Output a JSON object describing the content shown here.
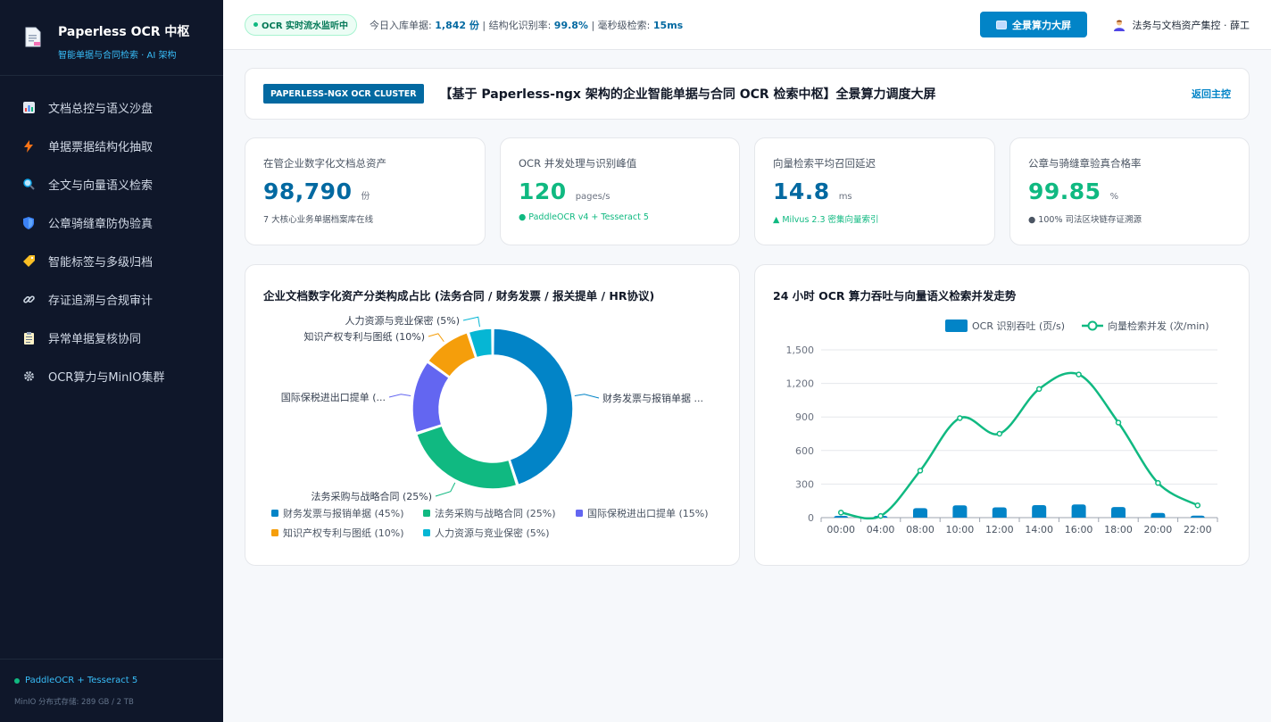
{
  "sidebar": {
    "title": "Paperless OCR 中枢",
    "subtitle": "智能单据与合同检索 · AI 架构",
    "items": [
      {
        "label": "文档总控与语义沙盘",
        "icon": "bar-chart-icon"
      },
      {
        "label": "单据票据结构化抽取",
        "icon": "lightning-icon"
      },
      {
        "label": "全文与向量语义检索",
        "icon": "magnifier-icon"
      },
      {
        "label": "公章骑缝章防伪验真",
        "icon": "shield-icon"
      },
      {
        "label": "智能标签与多级归档",
        "icon": "tag-icon"
      },
      {
        "label": "存证追溯与合规审计",
        "icon": "link-icon"
      },
      {
        "label": "异常单据复核协同",
        "icon": "clipboard-icon"
      },
      {
        "label": "OCR算力与MinIO集群",
        "icon": "gear-icon"
      }
    ],
    "footer_status": "PaddleOCR + Tesseract 5",
    "footer_storage": "MinIO 分布式存储: 289 GB / 2 TB"
  },
  "topbar": {
    "live_badge": "OCR 实时流水监听中",
    "stat1_label": "今日入库单据:",
    "stat1_value": "1,842 份",
    "stat2_label": "| 结构化识别率:",
    "stat2_value": "99.8%",
    "stat3_label": "| 毫秒级检索:",
    "stat3_value": "15ms",
    "screen_button": "全景算力大屏",
    "user": "法务与文档资产集控 · 薛工"
  },
  "banner": {
    "tag": "PAPERLESS-NGX OCR CLUSTER",
    "title": "【基于 Paperless-ngx 架构的企业智能单据与合同 OCR 检索中枢】全景算力调度大屏",
    "back": "返回主控"
  },
  "kpis": [
    {
      "label": "在管企业数字化文档总资产",
      "value": "98,790",
      "unit": "份",
      "note": "7 大核心业务单据档案库在线",
      "color": "#0369a1",
      "note_color": "#4b5563"
    },
    {
      "label": "OCR 并发处理与识别峰值",
      "value": "120",
      "unit": "pages/s",
      "note": "● PaddleOCR v4 + Tesseract 5",
      "color": "#10b981",
      "note_color": "#10b981"
    },
    {
      "label": "向量检索平均召回延迟",
      "value": "14.8",
      "unit": "ms",
      "note": "▲ Milvus 2.3 密集向量索引",
      "color": "#0369a1",
      "note_color": "#10b981"
    },
    {
      "label": "公章与骑缝章验真合格率",
      "value": "99.85",
      "unit": "%",
      "note": "● 100% 司法区块链存证溯源",
      "color": "#10b981",
      "note_color": "#4b5563"
    }
  ],
  "panels": {
    "pie_title": "企业文档数字化资产分类构成占比 (法务合同 / 财务发票 / 报关提单 / HR协议)",
    "line_title": "24 小时 OCR 算力吞吐与向量语义检索并发走势"
  },
  "chart_data": [
    {
      "type": "pie",
      "title": "企业文档数字化资产分类构成占比 (法务合同 / 财务发票 / 报关提单 / HR协议)",
      "slices": [
        {
          "name": "财务发票与报销单据",
          "value": 45,
          "label": "财务发票与报销单据 ...",
          "color": "#0284c7"
        },
        {
          "name": "法务采购与战略合同",
          "value": 25,
          "label": "法务采购与战略合同 (25%)",
          "color": "#10b981"
        },
        {
          "name": "国际保税进出口提单",
          "value": 15,
          "label": "国际保税进出口提单 (...",
          "color": "#6366f1"
        },
        {
          "name": "知识产权专利与图纸",
          "value": 10,
          "label": "知识产权专利与图纸 (10%)",
          "color": "#f59e0b"
        },
        {
          "name": "人力资源与竞业保密",
          "value": 5,
          "label": "人力资源与竞业保密 (5%)",
          "color": "#06b6d4"
        }
      ],
      "legend": [
        "财务发票与报销单据 (45%)",
        "法务采购与战略合同 (25%)",
        "国际保税进出口提单 (15%)",
        "知识产权专利与图纸 (10%)",
        "人力资源与竞业保密 (5%)"
      ],
      "legend_position": "bottom"
    },
    {
      "type": "bar+line",
      "title": "24 小时 OCR 算力吞吐与向量语义检索并发走势",
      "categories": [
        "00:00",
        "04:00",
        "08:00",
        "10:00",
        "12:00",
        "14:00",
        "16:00",
        "18:00",
        "20:00",
        "22:00"
      ],
      "series": [
        {
          "name": "OCR 识别吞吐 (页/s)",
          "type": "bar",
          "values": [
            12,
            8,
            85,
            110,
            92,
            112,
            118,
            95,
            42,
            18
          ],
          "color": "#0284c7"
        },
        {
          "name": "向量检索并发 (次/min)",
          "type": "line",
          "values": [
            45,
            15,
            420,
            890,
            750,
            1150,
            1280,
            850,
            310,
            110
          ],
          "color": "#10b981"
        }
      ],
      "y_ticks": [
        "0",
        "300",
        "600",
        "900",
        "1,200",
        "1,500"
      ],
      "ylim": [
        0,
        1500
      ],
      "legend_position": "top-right",
      "grid": true
    }
  ]
}
